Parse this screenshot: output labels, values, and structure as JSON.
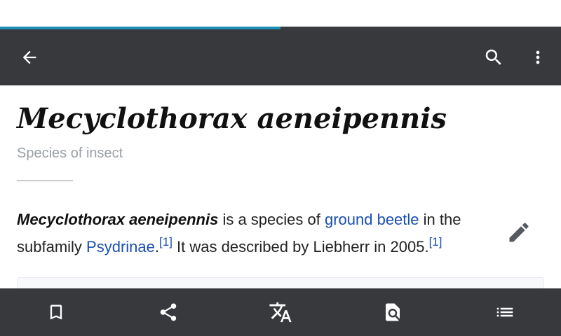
{
  "loading": {
    "progress": 0.5
  },
  "toolbar": {
    "back_icon": "arrow-back-icon",
    "search_icon": "search-icon",
    "more_icon": "more-vert-icon"
  },
  "article": {
    "title": "Mecyclothorax aeneipennis",
    "description": "Species of insect",
    "paragraph": {
      "subject": "Mecyclothorax aeneipennis",
      "text1": " is a species of ",
      "link1": "ground beetle",
      "text2": " in the subfamily ",
      "link2": "Psydrinae",
      "text3": ".",
      "ref1": "[1]",
      "text4": " It was described by Liebherr in 2005.",
      "ref2": "[1]"
    },
    "edit_icon": "pencil-icon"
  },
  "bottom_bar": {
    "items": [
      "bookmark-icon",
      "share-icon",
      "translate-icon",
      "find-in-page-icon",
      "table-of-contents-icon"
    ]
  },
  "colors": {
    "toolbar": "#37393d",
    "progress": "#1f8fb8",
    "link": "#1a4fb0"
  }
}
